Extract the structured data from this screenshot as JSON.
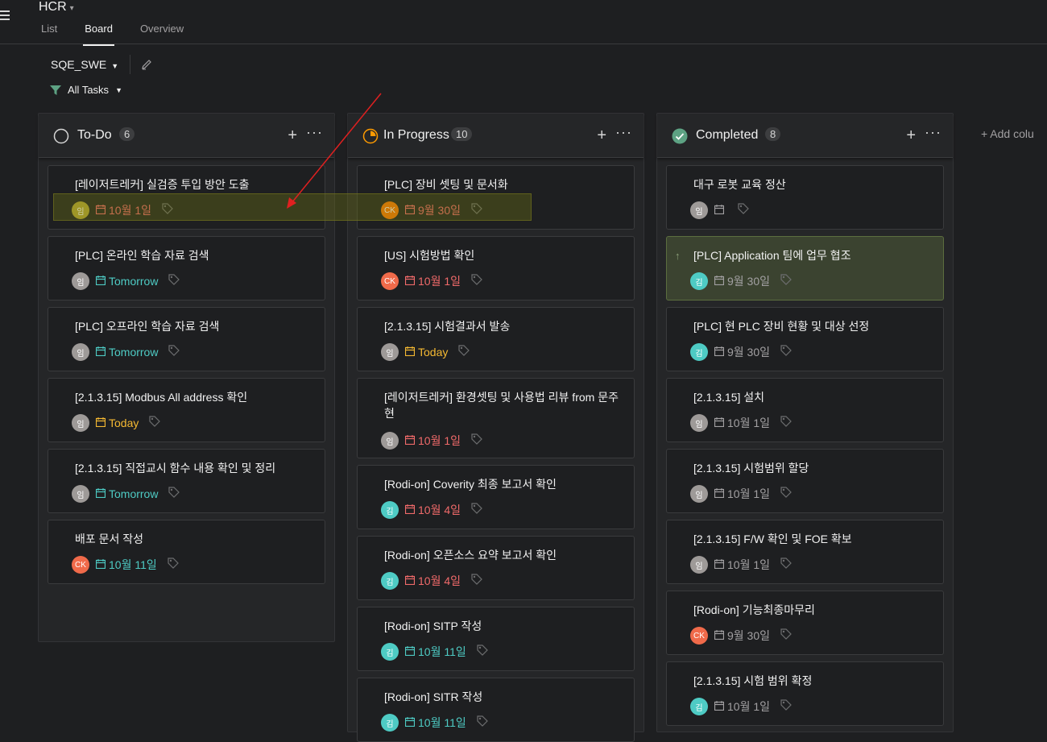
{
  "header": {
    "project_title": "HCR",
    "tabs": [
      {
        "label": "List"
      },
      {
        "label": "Board"
      },
      {
        "label": "Overview"
      }
    ]
  },
  "toolbar": {
    "team_label": "SQE_SWE",
    "filter_label": "All Tasks"
  },
  "add_column_label": "Add colu",
  "colors": {
    "red": "#f06a6a",
    "teal": "#4ecbc4",
    "orange": "#fd9a00",
    "yellow": "#f5b932",
    "grey": "#a2a0a2",
    "green_check": "#5da283"
  },
  "columns": [
    {
      "title": "To-Do",
      "count": "6",
      "cards": [
        {
          "title": "[레이저트레커] 실검증 투입 방안 도출",
          "avatar": "임",
          "avatar_color": "#b6a632",
          "due": "10월 1일",
          "due_color": "#f06a6a"
        },
        {
          "title": "[PLC] 온라인 학습 자료 검색",
          "avatar": "임",
          "avatar_color": "#9e9a98",
          "due": "Tomorrow",
          "due_color": "#4ecbc4"
        },
        {
          "title": "[PLC] 오프라인 학습 자료 검색",
          "avatar": "임",
          "avatar_color": "#9e9a98",
          "due": "Tomorrow",
          "due_color": "#4ecbc4"
        },
        {
          "title": "[2.1.3.15] Modbus All address 확인",
          "avatar": "임",
          "avatar_color": "#9e9a98",
          "due": "Today",
          "due_color": "#f5b932"
        },
        {
          "title": "[2.1.3.15] 직접교시 함수 내용 확인 및 정리",
          "avatar": "임",
          "avatar_color": "#9e9a98",
          "due": "Tomorrow",
          "due_color": "#4ecbc4"
        },
        {
          "title": "배포 문서 작성",
          "avatar": "CK",
          "avatar_color": "#f06a4a",
          "due": "10월 11일",
          "due_color": "#4ecbc4"
        }
      ]
    },
    {
      "title": "In Progress",
      "count": "10",
      "cards": [
        {
          "title": "[PLC] 장비 셋팅 및 문서화",
          "avatar": "CK",
          "avatar_color": "#fd7a00",
          "due": "9월 30일",
          "due_color": "#f06a6a"
        },
        {
          "title": "[US] 시험방법 확인",
          "avatar": "CK",
          "avatar_color": "#f06a4a",
          "due": "10월 1일",
          "due_color": "#f06a6a"
        },
        {
          "title": "[2.1.3.15] 시험결과서 발송",
          "avatar": "임",
          "avatar_color": "#9e9a98",
          "due": "Today",
          "due_color": "#f5b932"
        },
        {
          "title": "[레이저트레커] 환경셋팅 및 사용법 리뷰 from 문주현",
          "avatar": "임",
          "avatar_color": "#9e9a98",
          "due": "10월 1일",
          "due_color": "#f06a6a"
        },
        {
          "title": "[Rodi-on] Coverity 최종 보고서 확인",
          "avatar": "김",
          "avatar_color": "#4ecbc4",
          "due": "10월 4일",
          "due_color": "#f06a6a"
        },
        {
          "title": "[Rodi-on] 오픈소스 요약 보고서 확인",
          "avatar": "김",
          "avatar_color": "#4ecbc4",
          "due": "10월 4일",
          "due_color": "#f06a6a"
        },
        {
          "title": "[Rodi-on] SITP 작성",
          "avatar": "김",
          "avatar_color": "#4ecbc4",
          "due": "10월 11일",
          "due_color": "#4ecbc4"
        },
        {
          "title": "[Rodi-on] SITR 작성",
          "avatar": "김",
          "avatar_color": "#4ecbc4",
          "due": "10월 11일",
          "due_color": "#4ecbc4"
        }
      ]
    },
    {
      "title": "Completed",
      "count": "8",
      "cards": [
        {
          "title": "대구 로봇 교육 정산",
          "avatar": "임",
          "avatar_color": "#9e9a98",
          "due": "",
          "due_color": "#a2a0a2"
        },
        {
          "title": "[PLC] Application 팀에 업무 협조",
          "avatar": "김",
          "avatar_color": "#4ecbc4",
          "due": "9월 30일",
          "due_color": "#a2a0a2"
        },
        {
          "title": "[PLC] 현 PLC 장비 현황 및 대상 선정",
          "avatar": "김",
          "avatar_color": "#4ecbc4",
          "due": "9월 30일",
          "due_color": "#a2a0a2"
        },
        {
          "title": "[2.1.3.15] 설치",
          "avatar": "임",
          "avatar_color": "#9e9a98",
          "due": "10월 1일",
          "due_color": "#a2a0a2"
        },
        {
          "title": "[2.1.3.15] 시험범위 할당",
          "avatar": "임",
          "avatar_color": "#9e9a98",
          "due": "10월 1일",
          "due_color": "#a2a0a2"
        },
        {
          "title": "[2.1.3.15] F/W 확인 및 FOE 확보",
          "avatar": "임",
          "avatar_color": "#9e9a98",
          "due": "10월 1일",
          "due_color": "#a2a0a2"
        },
        {
          "title": "[Rodi-on] 기능최종마무리",
          "avatar": "CK",
          "avatar_color": "#f06a4a",
          "due": "9월 30일",
          "due_color": "#a2a0a2"
        },
        {
          "title": "[2.1.3.15] 시험 범위 확정",
          "avatar": "김",
          "avatar_color": "#4ecbc4",
          "due": "10월 1일",
          "due_color": "#a2a0a2"
        }
      ]
    }
  ]
}
